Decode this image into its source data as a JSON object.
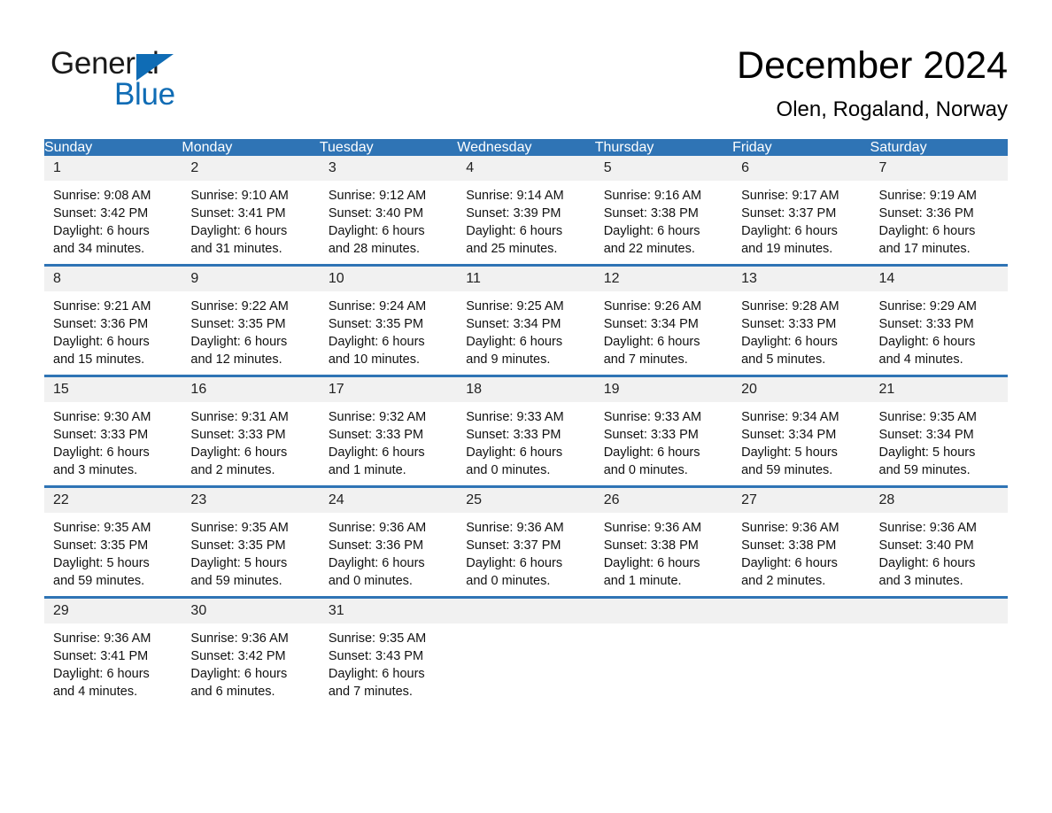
{
  "brand": {
    "name_part1": "General",
    "name_part2": "Blue",
    "triangle_color": "#0f6cb5",
    "text_color": "#1a1a1a"
  },
  "header": {
    "title": "December 2024",
    "subtitle": "Olen, Rogaland, Norway"
  },
  "theme": {
    "header_blue": "#2f74b5",
    "row_separator_blue": "#2f74b5",
    "daynum_band_gray": "#f1f1f1",
    "text_black": "#111111"
  },
  "weekday_headers": [
    "Sunday",
    "Monday",
    "Tuesday",
    "Wednesday",
    "Thursday",
    "Friday",
    "Saturday"
  ],
  "weeks": [
    {
      "days": [
        {
          "day": "1",
          "sunrise": "Sunrise: 9:08 AM",
          "sunset": "Sunset: 3:42 PM",
          "daylight_line1": "Daylight: 6 hours",
          "daylight_line2": "and 34 minutes."
        },
        {
          "day": "2",
          "sunrise": "Sunrise: 9:10 AM",
          "sunset": "Sunset: 3:41 PM",
          "daylight_line1": "Daylight: 6 hours",
          "daylight_line2": "and 31 minutes."
        },
        {
          "day": "3",
          "sunrise": "Sunrise: 9:12 AM",
          "sunset": "Sunset: 3:40 PM",
          "daylight_line1": "Daylight: 6 hours",
          "daylight_line2": "and 28 minutes."
        },
        {
          "day": "4",
          "sunrise": "Sunrise: 9:14 AM",
          "sunset": "Sunset: 3:39 PM",
          "daylight_line1": "Daylight: 6 hours",
          "daylight_line2": "and 25 minutes."
        },
        {
          "day": "5",
          "sunrise": "Sunrise: 9:16 AM",
          "sunset": "Sunset: 3:38 PM",
          "daylight_line1": "Daylight: 6 hours",
          "daylight_line2": "and 22 minutes."
        },
        {
          "day": "6",
          "sunrise": "Sunrise: 9:17 AM",
          "sunset": "Sunset: 3:37 PM",
          "daylight_line1": "Daylight: 6 hours",
          "daylight_line2": "and 19 minutes."
        },
        {
          "day": "7",
          "sunrise": "Sunrise: 9:19 AM",
          "sunset": "Sunset: 3:36 PM",
          "daylight_line1": "Daylight: 6 hours",
          "daylight_line2": "and 17 minutes."
        }
      ]
    },
    {
      "days": [
        {
          "day": "8",
          "sunrise": "Sunrise: 9:21 AM",
          "sunset": "Sunset: 3:36 PM",
          "daylight_line1": "Daylight: 6 hours",
          "daylight_line2": "and 15 minutes."
        },
        {
          "day": "9",
          "sunrise": "Sunrise: 9:22 AM",
          "sunset": "Sunset: 3:35 PM",
          "daylight_line1": "Daylight: 6 hours",
          "daylight_line2": "and 12 minutes."
        },
        {
          "day": "10",
          "sunrise": "Sunrise: 9:24 AM",
          "sunset": "Sunset: 3:35 PM",
          "daylight_line1": "Daylight: 6 hours",
          "daylight_line2": "and 10 minutes."
        },
        {
          "day": "11",
          "sunrise": "Sunrise: 9:25 AM",
          "sunset": "Sunset: 3:34 PM",
          "daylight_line1": "Daylight: 6 hours",
          "daylight_line2": "and 9 minutes."
        },
        {
          "day": "12",
          "sunrise": "Sunrise: 9:26 AM",
          "sunset": "Sunset: 3:34 PM",
          "daylight_line1": "Daylight: 6 hours",
          "daylight_line2": "and 7 minutes."
        },
        {
          "day": "13",
          "sunrise": "Sunrise: 9:28 AM",
          "sunset": "Sunset: 3:33 PM",
          "daylight_line1": "Daylight: 6 hours",
          "daylight_line2": "and 5 minutes."
        },
        {
          "day": "14",
          "sunrise": "Sunrise: 9:29 AM",
          "sunset": "Sunset: 3:33 PM",
          "daylight_line1": "Daylight: 6 hours",
          "daylight_line2": "and 4 minutes."
        }
      ]
    },
    {
      "days": [
        {
          "day": "15",
          "sunrise": "Sunrise: 9:30 AM",
          "sunset": "Sunset: 3:33 PM",
          "daylight_line1": "Daylight: 6 hours",
          "daylight_line2": "and 3 minutes."
        },
        {
          "day": "16",
          "sunrise": "Sunrise: 9:31 AM",
          "sunset": "Sunset: 3:33 PM",
          "daylight_line1": "Daylight: 6 hours",
          "daylight_line2": "and 2 minutes."
        },
        {
          "day": "17",
          "sunrise": "Sunrise: 9:32 AM",
          "sunset": "Sunset: 3:33 PM",
          "daylight_line1": "Daylight: 6 hours",
          "daylight_line2": "and 1 minute."
        },
        {
          "day": "18",
          "sunrise": "Sunrise: 9:33 AM",
          "sunset": "Sunset: 3:33 PM",
          "daylight_line1": "Daylight: 6 hours",
          "daylight_line2": "and 0 minutes."
        },
        {
          "day": "19",
          "sunrise": "Sunrise: 9:33 AM",
          "sunset": "Sunset: 3:33 PM",
          "daylight_line1": "Daylight: 6 hours",
          "daylight_line2": "and 0 minutes."
        },
        {
          "day": "20",
          "sunrise": "Sunrise: 9:34 AM",
          "sunset": "Sunset: 3:34 PM",
          "daylight_line1": "Daylight: 5 hours",
          "daylight_line2": "and 59 minutes."
        },
        {
          "day": "21",
          "sunrise": "Sunrise: 9:35 AM",
          "sunset": "Sunset: 3:34 PM",
          "daylight_line1": "Daylight: 5 hours",
          "daylight_line2": "and 59 minutes."
        }
      ]
    },
    {
      "days": [
        {
          "day": "22",
          "sunrise": "Sunrise: 9:35 AM",
          "sunset": "Sunset: 3:35 PM",
          "daylight_line1": "Daylight: 5 hours",
          "daylight_line2": "and 59 minutes."
        },
        {
          "day": "23",
          "sunrise": "Sunrise: 9:35 AM",
          "sunset": "Sunset: 3:35 PM",
          "daylight_line1": "Daylight: 5 hours",
          "daylight_line2": "and 59 minutes."
        },
        {
          "day": "24",
          "sunrise": "Sunrise: 9:36 AM",
          "sunset": "Sunset: 3:36 PM",
          "daylight_line1": "Daylight: 6 hours",
          "daylight_line2": "and 0 minutes."
        },
        {
          "day": "25",
          "sunrise": "Sunrise: 9:36 AM",
          "sunset": "Sunset: 3:37 PM",
          "daylight_line1": "Daylight: 6 hours",
          "daylight_line2": "and 0 minutes."
        },
        {
          "day": "26",
          "sunrise": "Sunrise: 9:36 AM",
          "sunset": "Sunset: 3:38 PM",
          "daylight_line1": "Daylight: 6 hours",
          "daylight_line2": "and 1 minute."
        },
        {
          "day": "27",
          "sunrise": "Sunrise: 9:36 AM",
          "sunset": "Sunset: 3:38 PM",
          "daylight_line1": "Daylight: 6 hours",
          "daylight_line2": "and 2 minutes."
        },
        {
          "day": "28",
          "sunrise": "Sunrise: 9:36 AM",
          "sunset": "Sunset: 3:40 PM",
          "daylight_line1": "Daylight: 6 hours",
          "daylight_line2": "and 3 minutes."
        }
      ]
    },
    {
      "days": [
        {
          "day": "29",
          "sunrise": "Sunrise: 9:36 AM",
          "sunset": "Sunset: 3:41 PM",
          "daylight_line1": "Daylight: 6 hours",
          "daylight_line2": "and 4 minutes."
        },
        {
          "day": "30",
          "sunrise": "Sunrise: 9:36 AM",
          "sunset": "Sunset: 3:42 PM",
          "daylight_line1": "Daylight: 6 hours",
          "daylight_line2": "and 6 minutes."
        },
        {
          "day": "31",
          "sunrise": "Sunrise: 9:35 AM",
          "sunset": "Sunset: 3:43 PM",
          "daylight_line1": "Daylight: 6 hours",
          "daylight_line2": "and 7 minutes."
        },
        {
          "day": "",
          "sunrise": "",
          "sunset": "",
          "daylight_line1": "",
          "daylight_line2": ""
        },
        {
          "day": "",
          "sunrise": "",
          "sunset": "",
          "daylight_line1": "",
          "daylight_line2": ""
        },
        {
          "day": "",
          "sunrise": "",
          "sunset": "",
          "daylight_line1": "",
          "daylight_line2": ""
        },
        {
          "day": "",
          "sunrise": "",
          "sunset": "",
          "daylight_line1": "",
          "daylight_line2": ""
        }
      ]
    }
  ]
}
